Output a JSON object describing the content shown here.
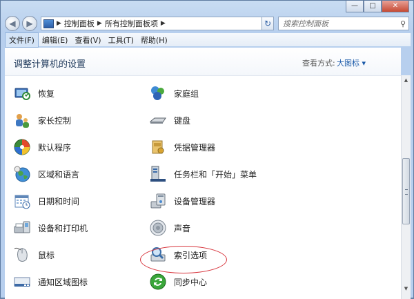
{
  "address": {
    "segments": [
      "控制面板",
      "所有控制面板项"
    ]
  },
  "search": {
    "placeholder": "搜索控制面板"
  },
  "menu": [
    {
      "label": "文件(F)",
      "active": true
    },
    {
      "label": "编辑(E)",
      "active": false
    },
    {
      "label": "查看(V)",
      "active": false
    },
    {
      "label": "工具(T)",
      "active": false
    },
    {
      "label": "帮助(H)",
      "active": false
    }
  ],
  "header": {
    "title": "调整计算机的设置",
    "view_label": "查看方式:",
    "view_value": "大图标 ▾"
  },
  "items": {
    "left": [
      {
        "label": "恢复",
        "icon": "recovery-icon"
      },
      {
        "label": "家长控制",
        "icon": "parental-controls-icon"
      },
      {
        "label": "默认程序",
        "icon": "default-programs-icon"
      },
      {
        "label": "区域和语言",
        "icon": "region-language-icon"
      },
      {
        "label": "日期和时间",
        "icon": "date-time-icon"
      },
      {
        "label": "设备和打印机",
        "icon": "devices-printers-icon"
      },
      {
        "label": "鼠标",
        "icon": "mouse-icon"
      },
      {
        "label": "通知区域图标",
        "icon": "notification-area-icon"
      }
    ],
    "right": [
      {
        "label": "家庭组",
        "icon": "homegroup-icon"
      },
      {
        "label": "键盘",
        "icon": "keyboard-icon"
      },
      {
        "label": "凭据管理器",
        "icon": "credential-manager-icon"
      },
      {
        "label": "任务栏和「开始」菜单",
        "icon": "taskbar-start-icon"
      },
      {
        "label": "设备管理器",
        "icon": "device-manager-icon"
      },
      {
        "label": "声音",
        "icon": "sound-icon"
      },
      {
        "label": "索引选项",
        "icon": "indexing-options-icon"
      },
      {
        "label": "同步中心",
        "icon": "sync-center-icon"
      }
    ]
  },
  "colors": {
    "highlight_ellipse": "#d7343c",
    "link": "#1a5aa9"
  }
}
